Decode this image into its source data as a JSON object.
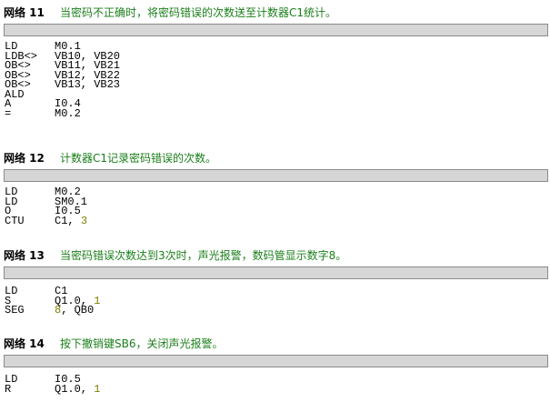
{
  "networks": [
    {
      "label": "网络 11",
      "comment": "当密码不正确时，将密码错误的次数送至计数器C1统计。",
      "lines": [
        {
          "op": "LD",
          "arg": "M0.1"
        },
        {
          "op": "LDB<>",
          "arg": "VB10, VB20"
        },
        {
          "op": "OB<>",
          "arg": "VB11, VB21"
        },
        {
          "op": "OB<>",
          "arg": "VB12, VB22"
        },
        {
          "op": "OB<>",
          "arg": "VB13, VB23"
        },
        {
          "op": "ALD",
          "arg": ""
        },
        {
          "op": "A",
          "arg": "I0.4"
        },
        {
          "op": "=",
          "arg": "M0.2"
        }
      ]
    },
    {
      "label": "网络 12",
      "comment": "计数器C1记录密码错误的次数。",
      "lines": [
        {
          "op": "LD",
          "arg": "M0.2"
        },
        {
          "op": "LD",
          "arg": "SM0.1"
        },
        {
          "op": "O",
          "arg": "I0.5"
        },
        {
          "op": "CTU",
          "arg": "C1, ",
          "num": "3"
        }
      ]
    },
    {
      "label": "网络 13",
      "comment": "当密码错误次数达到3次时，声光报警，数码管显示数字8。",
      "lines": [
        {
          "op": "LD",
          "arg": "C1"
        },
        {
          "op": "S",
          "arg": "Q1.0, ",
          "num": "1"
        },
        {
          "op": "SEG",
          "num_first": "8",
          "arg": ", QB0"
        }
      ]
    },
    {
      "label": "网络 14",
      "comment": "按下撤销键SB6，关闭声光报警。",
      "lines": [
        {
          "op": "LD",
          "arg": "I0.5"
        },
        {
          "op": "R",
          "arg": "Q1.0, ",
          "num": "1"
        }
      ]
    }
  ],
  "colors": {
    "comment": "#1a7f1a",
    "constant": "#808000",
    "title_box": "#d6d6d6"
  }
}
